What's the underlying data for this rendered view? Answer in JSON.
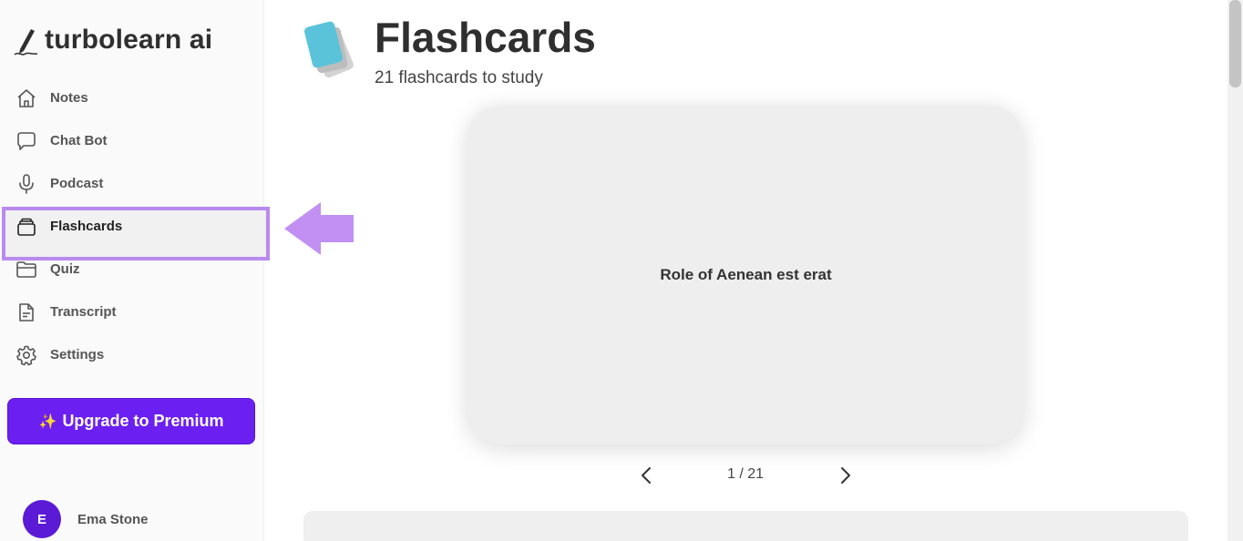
{
  "app": {
    "name": "turbolearn ai"
  },
  "sidebar": {
    "items": [
      {
        "label": "Notes",
        "icon": "home-icon"
      },
      {
        "label": "Chat Bot",
        "icon": "chat-icon"
      },
      {
        "label": "Podcast",
        "icon": "microphone-icon"
      },
      {
        "label": "Flashcards",
        "icon": "cards-icon",
        "active": true
      },
      {
        "label": "Quiz",
        "icon": "folder-icon"
      },
      {
        "label": "Transcript",
        "icon": "document-icon"
      },
      {
        "label": "Settings",
        "icon": "gear-icon"
      }
    ],
    "upgrade": {
      "label": "Upgrade to Premium",
      "icon": "sparkle-icon"
    },
    "user": {
      "initial": "E",
      "name": "Ema Stone"
    }
  },
  "main": {
    "title": "Flashcards",
    "subtitle": "21 flashcards to study",
    "card": {
      "text": "Role of Aenean est erat"
    },
    "pager": {
      "text": "1 / 21"
    }
  },
  "colors": {
    "accent": "#6b1ff0",
    "highlight": "#b98aef",
    "avatar": "#5b1ad6",
    "card": "#eeeeef"
  }
}
